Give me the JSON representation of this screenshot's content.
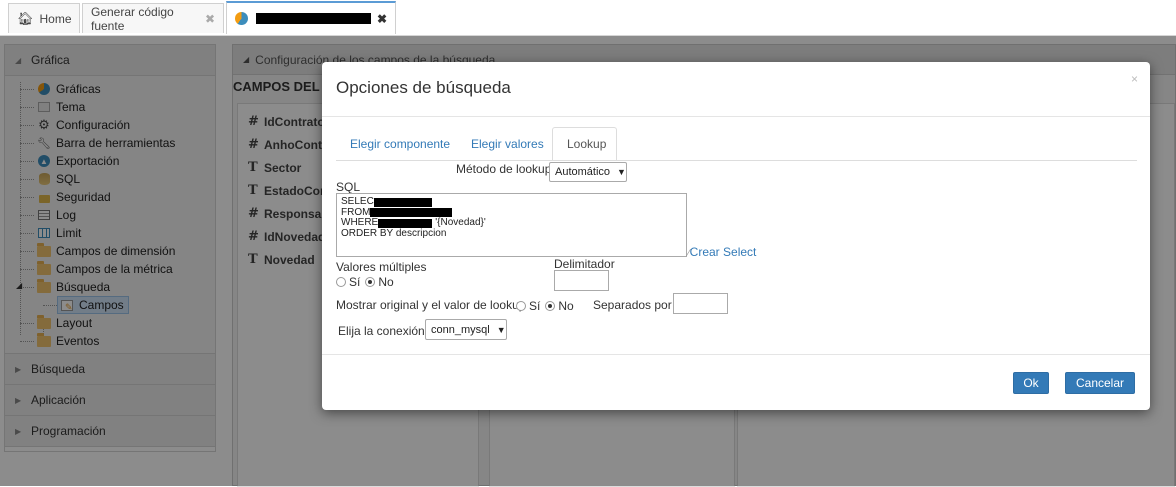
{
  "tabs": [
    {
      "label": "Home",
      "icon": "home-icon"
    },
    {
      "label": "Generar código fuente",
      "close": "✖"
    },
    {
      "label": "",
      "redacted": true,
      "icon": "pie-chart-icon",
      "close": "✖"
    }
  ],
  "sidebar": {
    "sections": [
      {
        "label": "Gráfica",
        "expanded": true
      },
      {
        "label": "Búsqueda",
        "expanded": false
      },
      {
        "label": "Aplicación",
        "expanded": false
      },
      {
        "label": "Programación",
        "expanded": false
      }
    ],
    "tree": [
      {
        "label": "Gráficas",
        "icon": "pie-chart-icon"
      },
      {
        "label": "Tema",
        "icon": "theme-icon"
      },
      {
        "label": "Configuración",
        "icon": "gear-icon"
      },
      {
        "label": "Barra de herramientas",
        "icon": "wrench-icon"
      },
      {
        "label": "Exportación",
        "icon": "export-icon"
      },
      {
        "label": "SQL",
        "icon": "database-icon"
      },
      {
        "label": "Seguridad",
        "icon": "lock-icon"
      },
      {
        "label": "Log",
        "icon": "log-icon"
      },
      {
        "label": "Limit",
        "icon": "table-icon"
      },
      {
        "label": "Campos de dimensión",
        "icon": "folder-icon"
      },
      {
        "label": "Campos de la métrica",
        "icon": "folder-icon"
      },
      {
        "label": "Búsqueda",
        "icon": "folder-icon"
      },
      {
        "label": "Campos",
        "icon": "edit-icon",
        "selected": true
      },
      {
        "label": "Layout",
        "icon": "folder-icon"
      },
      {
        "label": "Eventos",
        "icon": "folder-icon"
      }
    ]
  },
  "background_panel": {
    "header": "Configuración de los campos de la búsqueda",
    "title": "CAMPOS DEL C",
    "fields": [
      {
        "type": "#",
        "label": "IdContrato"
      },
      {
        "type": "#",
        "label": "AnhoContra"
      },
      {
        "type": "T",
        "label": "Sector"
      },
      {
        "type": "T",
        "label": "EstadoCont"
      },
      {
        "type": "#",
        "label": "Responsabl"
      },
      {
        "type": "#",
        "label": "IdNovedad"
      },
      {
        "type": "T",
        "label": "Novedad"
      }
    ]
  },
  "modal": {
    "title": "Opciones de búsqueda",
    "close": "×",
    "tabs": [
      "Elegir componente",
      "Elegir valores",
      "Lookup"
    ],
    "active_tab": "Lookup",
    "lookup_method_label": "Método de lookup",
    "lookup_method_value": "Automático",
    "sql_label": "SQL",
    "sql_lines": [
      {
        "text": "SELEC",
        "tail": ""
      },
      {
        "text": "FROM ",
        "tail": ""
      },
      {
        "text": "WHERE ",
        "tail": "'{Novedad}'"
      },
      {
        "text": "ORDER BY descripcion",
        "tail": ""
      }
    ],
    "create_select_link": "Crear Select",
    "multiple_values_label": "Valores múltiples",
    "yes": "Sí",
    "no": "No",
    "delimiter_label": "Delimitador",
    "show_original_label": "Mostrar original y el valor de lookup",
    "separated_by_label": "Separados por",
    "connection_label": "Elija la conexión",
    "connection_value": "conn_mysql",
    "ok_label": "Ok",
    "cancel_label": "Cancelar"
  }
}
